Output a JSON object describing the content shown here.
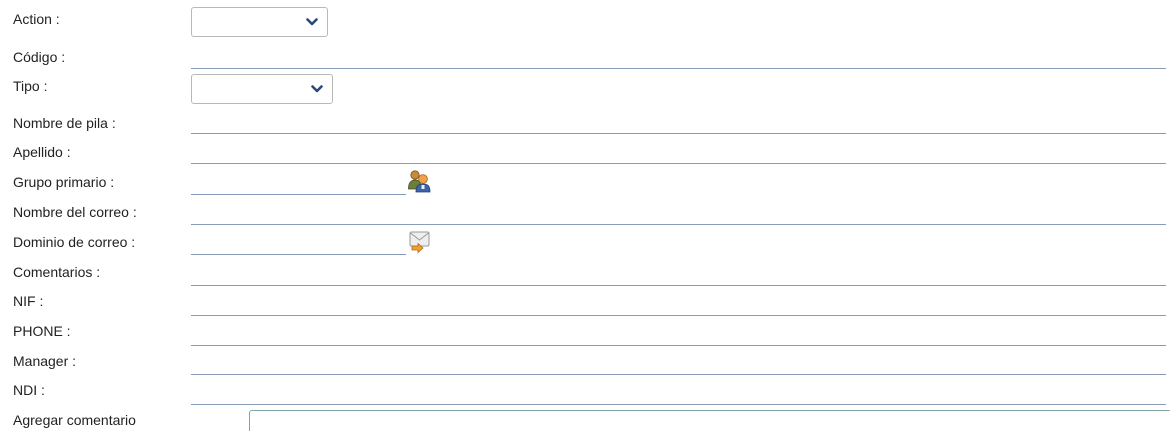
{
  "fields": {
    "action": {
      "label": "Action :",
      "value": ""
    },
    "codigo": {
      "label": "Código :",
      "value": ""
    },
    "tipo": {
      "label": "Tipo :",
      "value": ""
    },
    "nombre_de_pila": {
      "label": "Nombre de pila :",
      "value": ""
    },
    "apellido": {
      "label": "Apellido :",
      "value": ""
    },
    "grupo_primario": {
      "label": "Grupo primario :",
      "value": "",
      "icon": "user-group-icon"
    },
    "nombre_del_correo": {
      "label": "Nombre del correo :",
      "value": ""
    },
    "dominio_de_correo": {
      "label": "Dominio de correo :",
      "value": "",
      "icon": "mail-domain-icon"
    },
    "comentarios": {
      "label": "Comentarios :",
      "value": ""
    },
    "nif": {
      "label": "NIF :",
      "value": ""
    },
    "phone": {
      "label": "PHONE :",
      "value": ""
    },
    "manager": {
      "label": "Manager :",
      "value": ""
    },
    "ndi": {
      "label": "NDI :",
      "value": ""
    },
    "agregar_comentario": {
      "label": "Agregar comentario",
      "value": ""
    }
  },
  "colors": {
    "underline": "#8a9bb8",
    "chevron": "#2b4a7a",
    "textarea_border": "#7fa7a5"
  }
}
